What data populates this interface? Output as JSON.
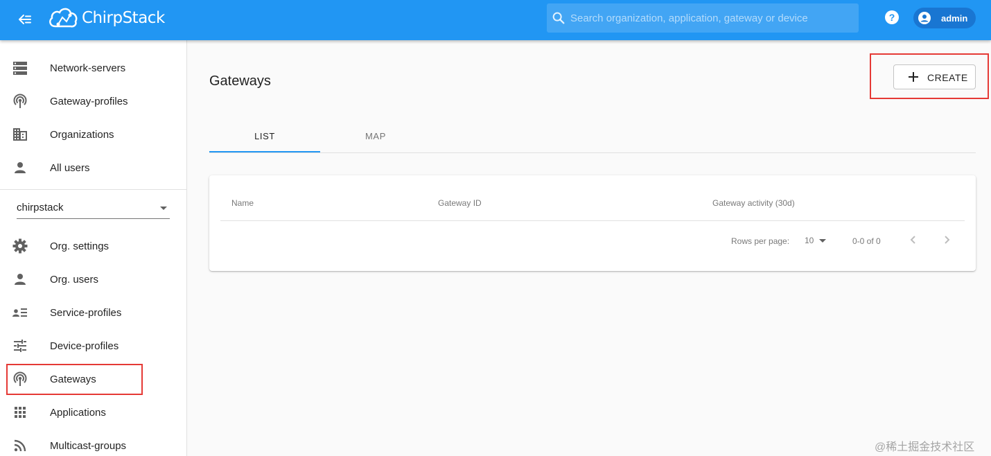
{
  "header": {
    "app_name": "ChirpStack",
    "search_placeholder": "Search organization, application, gateway or device",
    "user_name": "admin"
  },
  "sidebar": {
    "global_items": [
      {
        "label": "Network-servers",
        "icon": "server-icon"
      },
      {
        "label": "Gateway-profiles",
        "icon": "gateway-icon"
      },
      {
        "label": "Organizations",
        "icon": "building-icon"
      },
      {
        "label": "All users",
        "icon": "person-icon"
      }
    ],
    "organization_selected": "chirpstack",
    "org_items": [
      {
        "label": "Org. settings",
        "icon": "gear-icon"
      },
      {
        "label": "Org. users",
        "icon": "person-icon"
      },
      {
        "label": "Service-profiles",
        "icon": "account-list-icon"
      },
      {
        "label": "Device-profiles",
        "icon": "tune-icon"
      },
      {
        "label": "Gateways",
        "icon": "gateway-icon",
        "highlighted": true
      },
      {
        "label": "Applications",
        "icon": "apps-grid-icon"
      },
      {
        "label": "Multicast-groups",
        "icon": "rss-icon"
      }
    ]
  },
  "main": {
    "title": "Gateways",
    "create_label": "CREATE",
    "tabs": [
      {
        "label": "LIST",
        "active": true
      },
      {
        "label": "MAP",
        "active": false
      }
    ],
    "table": {
      "columns": [
        "Name",
        "Gateway ID",
        "Gateway activity (30d)"
      ],
      "rows": []
    },
    "pagination": {
      "rows_per_page_label": "Rows per page:",
      "rows_per_page": "10",
      "range": "0-0 of 0"
    }
  },
  "watermark": "@稀土掘金技术社区",
  "colors": {
    "appbar": "#2196f3",
    "tab_indicator": "#2196f3",
    "highlight_box": "#e53935"
  }
}
